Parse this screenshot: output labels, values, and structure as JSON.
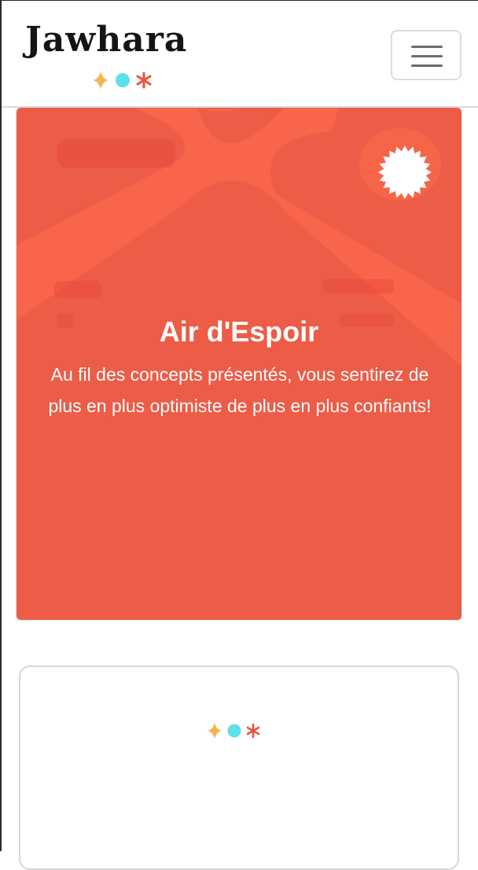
{
  "navbar": {
    "brand_name": "Jawhara",
    "brand_icons": [
      "sparkle-icon",
      "dot-icon",
      "asterisk-icon"
    ],
    "menu_icon": "hamburger-menu-icon"
  },
  "hero": {
    "title": "Air d'Espoir",
    "description": "Au fil des concepts présentés, vous sentirez de plus en plus optimiste de plus en plus confiants!",
    "badge_icon": "starburst-seal-icon"
  },
  "card2": {
    "icons": [
      "sparkle-icon",
      "dot-icon",
      "asterisk-icon"
    ]
  },
  "colors": {
    "hero_bg": "#ec5c47",
    "hero_accent": "#ff6a4b",
    "sparkle": "#f3b64a",
    "dot": "#5ee0e8",
    "asterisk": "#e9533f",
    "text_dark": "#141414"
  }
}
